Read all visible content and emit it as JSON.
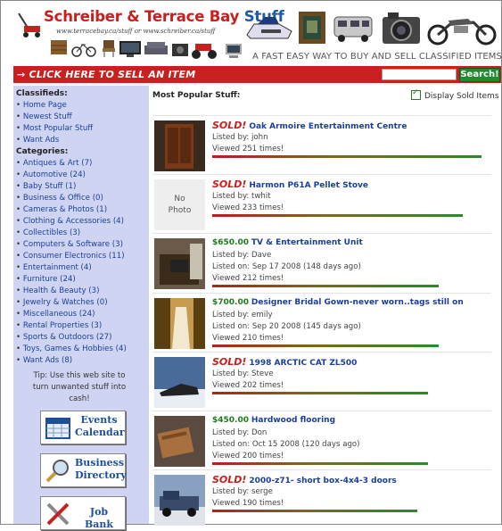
{
  "header": {
    "title_main": "Schreiber & Terrace Bay ",
    "title_stuff": "Stuff",
    "url_line": "www.terracebay.ca/stuff or www.schreiber.ca/stuff",
    "tagline": "A FAST EASY WAY TO BUY AND SELL CLASSIFIED ITEMS"
  },
  "topbar": {
    "sell_label": "→ CLICK HERE TO SELL AN ITEM",
    "search_value": "",
    "search_button": "Search!"
  },
  "sidebar": {
    "classifieds_heading": "Classifieds:",
    "classifieds": [
      "Home Page",
      "Newest Stuff",
      "Most Popular Stuff",
      "Want Ads"
    ],
    "categories_heading": "Categories:",
    "categories": [
      "Antiques & Art (7)",
      "Automotive (24)",
      "Baby Stuff (1)",
      "Business & Office (0)",
      "Cameras & Photos (1)",
      "Clothing & Accessories (4)",
      "Collectibles (3)",
      "Computers & Software (3)",
      "Consumer Electronics (11)",
      "Entertainment (4)",
      "Furniture (24)",
      "Health & Beauty (3)",
      "Jewelry & Watches (0)",
      "Miscellaneous (24)",
      "Rental Properties (3)",
      "Sports & Outdoors (27)",
      "Toys, Games & Hobbies (4)",
      "Want Ads (8)"
    ],
    "tip": "Tip: Use this web site to turn unwanted stuff into cash!",
    "buttons": [
      {
        "line1": "Events",
        "line2": "Calendar",
        "icon": "calendar-icon"
      },
      {
        "line1": "Business",
        "line2": "Directory",
        "icon": "magnifier-icon"
      },
      {
        "line1": "Job Bank",
        "line2": "",
        "icon": "tools-icon"
      }
    ]
  },
  "main": {
    "title": "Most Popular Stuff:",
    "sold_toggle_label": "Display Sold Items",
    "sold_toggle_checked": true,
    "no_photo_line1": "No",
    "no_photo_line2": "Photo",
    "listings": [
      {
        "status": "SOLD!",
        "price": "",
        "title": "Oak Armoire Entertainment Centre",
        "lister": "Listed by: john",
        "listed_on": "",
        "views": "Viewed 251 times!",
        "popularity": 1.0,
        "photo": "armoire"
      },
      {
        "status": "SOLD!",
        "price": "",
        "title": "Harmon P61A Pellet Stove",
        "lister": "Listed by: twhit",
        "listed_on": "",
        "views": "Viewed 233 times!",
        "popularity": 0.93,
        "photo": "none"
      },
      {
        "status": "",
        "price": "$650.00",
        "title": "TV & Entertainment Unit",
        "lister": "Listed by: Dave",
        "listed_on": "Listed on: Sep 17 2008 (148 days ago)",
        "views": "Viewed 212 times!",
        "popularity": 0.84,
        "photo": "tv"
      },
      {
        "status": "",
        "price": "$700.00",
        "title": "Designer Bridal Gown-never worn..tags still on",
        "lister": "Listed by: emily",
        "listed_on": "Listed on: Sep 20 2008 (145 days ago)",
        "views": "Viewed 210 times!",
        "popularity": 0.84,
        "photo": "gown"
      },
      {
        "status": "SOLD!",
        "price": "",
        "title": "1998 ARCTIC CAT ZL500",
        "lister": "Listed by: Steve",
        "listed_on": "",
        "views": "Viewed 202 times!",
        "popularity": 0.8,
        "photo": "snowmobile"
      },
      {
        "status": "",
        "price": "$450.00",
        "title": "Hardwood flooring",
        "lister": "Listed by: Don",
        "listed_on": "Listed on: Oct 15 2008 (120 days ago)",
        "views": "Viewed 200 times!",
        "popularity": 0.8,
        "photo": "flooring"
      },
      {
        "status": "SOLD!",
        "price": "",
        "title": "2000-z71- short box-4x4-3 doors",
        "lister": "Listed by: serge",
        "listed_on": "",
        "views": "Viewed 190 times!",
        "popularity": 0.76,
        "photo": "truck"
      }
    ]
  }
}
